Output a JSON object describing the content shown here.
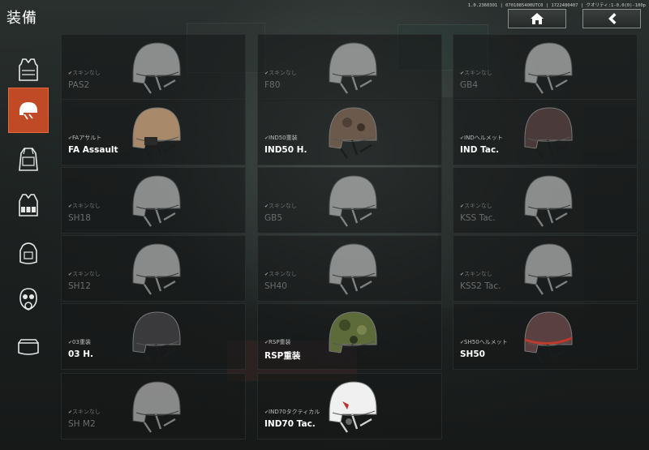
{
  "header": {
    "title": "装備",
    "version": "1.0.2360301 | 0701085400UTC0 | 1722480407 | クオリティ:1-0.0(0)-100p",
    "home_icon": "home-icon",
    "back_icon": "chevron-left-icon"
  },
  "sidebar": {
    "items": [
      {
        "icon": "vest-icon",
        "active": false
      },
      {
        "icon": "helmet-icon",
        "active": true
      },
      {
        "icon": "backpack-icon",
        "active": false
      },
      {
        "icon": "tactical-rig-icon",
        "active": false
      },
      {
        "icon": "pack-icon",
        "active": false
      },
      {
        "icon": "gas-mask-icon",
        "active": false
      },
      {
        "icon": "pouch-icon",
        "active": false
      }
    ],
    "active_color": "#c14a26"
  },
  "equipment": [
    {
      "skin": "スキンなし",
      "name": "PAS2",
      "style": "white",
      "owned": false
    },
    {
      "skin": "スキンなし",
      "name": "F80",
      "style": "white",
      "owned": false
    },
    {
      "skin": "スキンなし",
      "name": "GB4",
      "style": "white",
      "owned": false
    },
    {
      "skin": "FAアサルト",
      "name": "FA Assault",
      "style": "tan",
      "owned": true
    },
    {
      "skin": "IND50重装",
      "name": "IND50 H.",
      "style": "camo",
      "owned": true
    },
    {
      "skin": "INDヘルメット",
      "name": "IND Tac.",
      "style": "darkred",
      "owned": true
    },
    {
      "skin": "スキンなし",
      "name": "SH18",
      "style": "white",
      "owned": false
    },
    {
      "skin": "スキンなし",
      "name": "GB5",
      "style": "white",
      "owned": false
    },
    {
      "skin": "スキンなし",
      "name": "KSS Tac.",
      "style": "white",
      "owned": false
    },
    {
      "skin": "スキンなし",
      "name": "SH12",
      "style": "white",
      "owned": false
    },
    {
      "skin": "スキンなし",
      "name": "SH40",
      "style": "white",
      "owned": false
    },
    {
      "skin": "スキンなし",
      "name": "KSS2 Tac.",
      "style": "white",
      "owned": false
    },
    {
      "skin": "03重装",
      "name": "03 H.",
      "style": "black",
      "owned": true
    },
    {
      "skin": "RSP重装",
      "name": "RSP重装",
      "style": "green",
      "owned": true
    },
    {
      "skin": "SH50ヘルメット",
      "name": "SH50",
      "style": "red",
      "owned": true
    },
    {
      "skin": "スキンなし",
      "name": "SH M2",
      "style": "white",
      "owned": false
    },
    {
      "skin": "IND70タクティカル",
      "name": "IND70 Tac.",
      "style": "whitered",
      "owned": true
    }
  ],
  "helmet_colors": {
    "white": "#e6e6e6",
    "tan": "#a8896a",
    "camo": "#6b5a4c",
    "darkred": "#4a3a3a",
    "black": "#3a3a3c",
    "green": "#5d6b3a",
    "red": "#5a4040",
    "whitered": "#f0f0f0"
  }
}
